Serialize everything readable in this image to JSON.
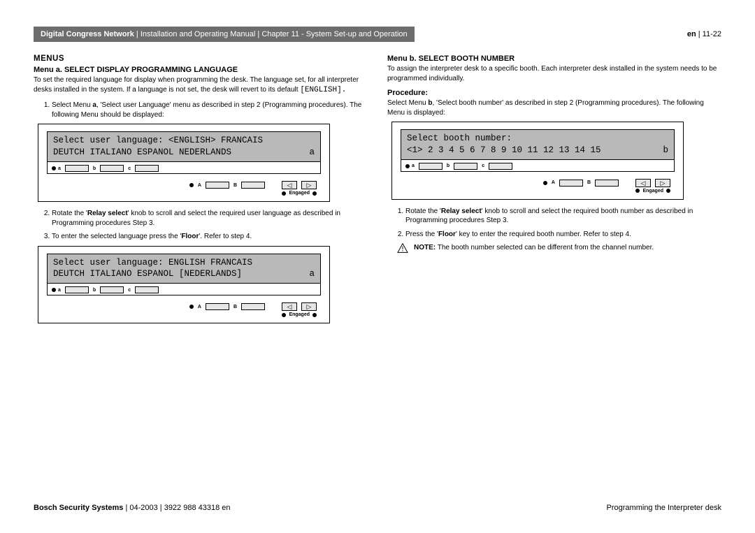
{
  "header": {
    "product": "Digital Congress Network",
    "doc": "Installation and Operating Manual",
    "chapter": "Chapter 11 - System Set-up and Operation",
    "lang": "en",
    "page": "11-22"
  },
  "left": {
    "section": "MENUS",
    "menuA_title": "Menu a.  SELECT DISPLAY PROGRAMMING LANGUAGE",
    "menuA_desc": "To set the required language for display when programming the desk. The language set, for all interpreter desks installed in the system. If a language is not set,  the desk will revert to its default ",
    "menuA_default": "[ENGLISH].",
    "step1": "Select Menu a, 'Select user Language' menu as described in step 2 (Programming procedures). The following Menu should be displayed:",
    "step1_bold": "a",
    "lcd1_line1": "Select user language: <ENGLISH> FRANCAIS",
    "lcd1_line2a": "DEUTCH ITALIANO ESPANOL NEDERLANDS",
    "lcd1_line2b": "a",
    "step2_pre": "Rotate the '",
    "step2_bold": "Relay select",
    "step2_post": "' knob to scroll and select the required user language as described in Programming procedures Step 3.",
    "step3_pre": "To enter the selected language press the '",
    "step3_bold": "Floor",
    "step3_post": "'. Refer to step 4.",
    "lcd2_line1": "Select user language: ENGLISH FRANCAIS",
    "lcd2_line2a": "DEUTCH ITALIANO ESPANOL [NEDERLANDS]",
    "lcd2_line2b": "a"
  },
  "right": {
    "menuB_title": "Menu b.  SELECT BOOTH NUMBER",
    "menuB_desc": "To assign the interpreter desk to a specific booth. Each interpreter desk installed in the system needs to be programmed individually.",
    "procedure": "Procedure:",
    "proc_desc_pre": "Select Menu ",
    "proc_desc_bold": "b",
    "proc_desc_post": ", 'Select booth number' as described in step 2 (Programming procedures). The following Menu is displayed:",
    "lcd_line1": "Select booth number:",
    "lcd_line2a": "<1> 2 3 4 5 6 7 8 9 10 11 12 13 14 15",
    "lcd_line2b": "b",
    "step1_pre": "Rotate the '",
    "step1_bold": "Relay select",
    "step1_post": "' knob to scroll and select the required booth number as described in Programming procedures Step 3.",
    "step2_pre": "Press the '",
    "step2_bold": "Floor",
    "step2_post": "' key to enter the required booth number. Refer to step 4.",
    "note_bold": "NOTE:",
    "note_text": " The booth number selected can be different from the channel number."
  },
  "device": {
    "labels_abc": [
      "a",
      "b",
      "c"
    ],
    "labels_AB": [
      "A",
      "B"
    ],
    "engaged": "Engaged",
    "left_arrow": "◁",
    "right_arrow": "▷"
  },
  "footer": {
    "left_bold": "Bosch Security Systems",
    "left_rest": " | 04-2003 | 3922 988 43318 en",
    "right": "Programming the Interpreter desk"
  }
}
